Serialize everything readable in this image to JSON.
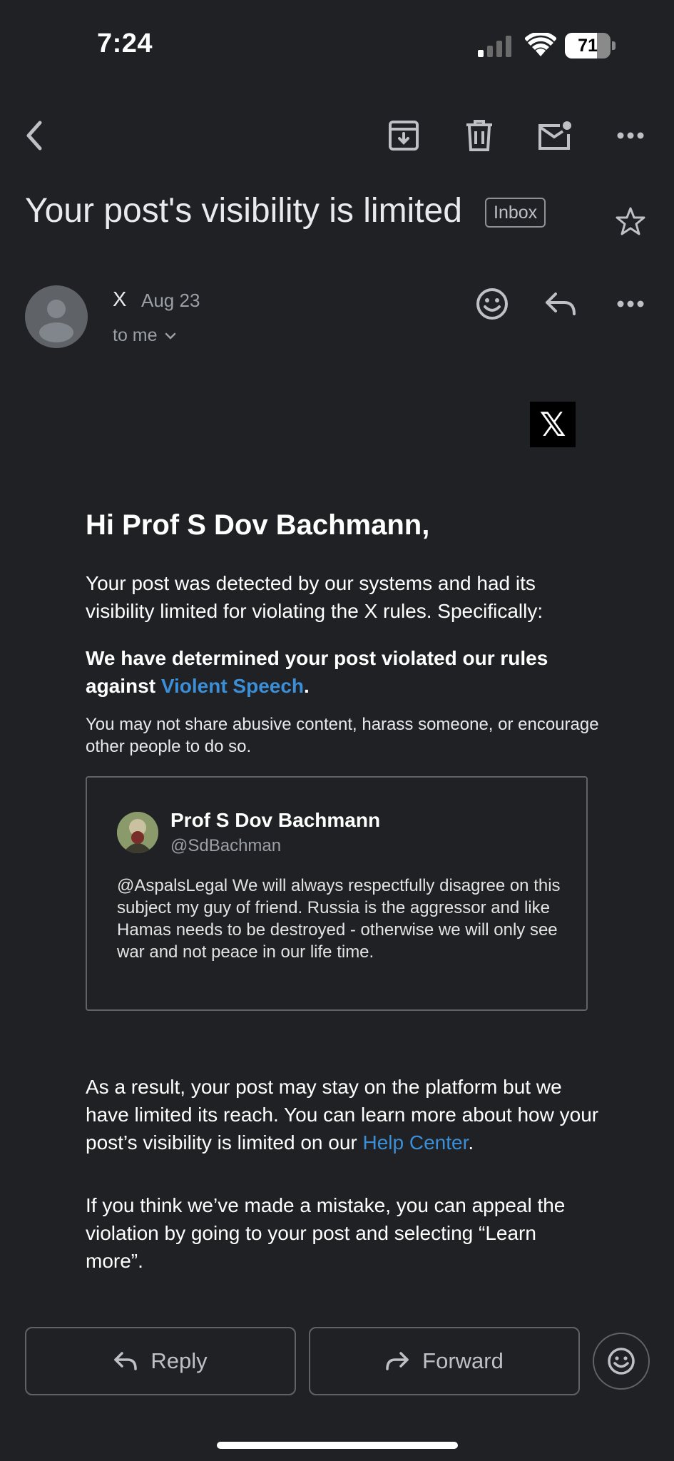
{
  "status_bar": {
    "time": "7:24",
    "battery_level": 71,
    "battery_label": "71"
  },
  "toolbar": {
    "back_icon": "chevron-left-icon",
    "archive_icon": "archive-icon",
    "delete_icon": "trash-icon",
    "mark_unread_icon": "mail-unread-icon",
    "more_icon": "more-horizontal-icon"
  },
  "email": {
    "subject": "Your post's visibility is limited",
    "label": "Inbox",
    "sender": "X",
    "date": "Aug 23",
    "recipient": "to me"
  },
  "body": {
    "logo_text": "𝕏",
    "greeting": "Hi Prof S Dov Bachmann,",
    "intro": "Your post was detected by our systems and had its visibility limited for violating the X rules. Specifically:",
    "determination_prefix": "We have determined your post violated our rules against ",
    "determination_link": "Violent Speech",
    "determination_suffix": ".",
    "rule_description": "You may not share abusive content, harass someone, or encourage other people to do so.",
    "quoted_post": {
      "author": "Prof S Dov Bachmann",
      "handle": "@SdBachman",
      "text": "@AspalsLegal We will always respectfully disagree on this subject my guy of friend. Russia is the aggressor and like Hamas needs to be destroyed - otherwise we will only see war and not peace in our life time."
    },
    "result_prefix": "As a result, your post may stay on the platform but we have limited its reach. You can learn more about how your post’s visibility is limited on our ",
    "result_link": "Help Center",
    "result_suffix": ".",
    "appeal": "If you think we’ve made a mistake, you can appeal the violation by going to your post and selecting “Learn more”."
  },
  "actions": {
    "reply": "Reply",
    "forward": "Forward"
  },
  "colors": {
    "background": "#202124",
    "link": "#3b8fd8",
    "border": "#5f6368"
  }
}
